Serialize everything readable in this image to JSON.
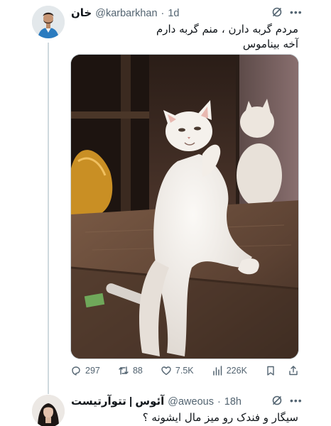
{
  "tweet": {
    "author_name": "خان",
    "handle": "@karbarkhan",
    "time": "1d",
    "text_line1": "مردم گربه دارن ، منم گربه دارم",
    "text_line2": "آخه بیناموس",
    "stats": {
      "replies": "297",
      "retweets": "88",
      "likes": "7.5K",
      "views": "226K"
    }
  },
  "reply": {
    "author_name": "آئوس | تتوآرتیست",
    "handle": "@aweous",
    "time": "18h",
    "text": "سیگار و فندک رو میز مال ایشونه ؟"
  },
  "icons": {
    "reply": "reply-icon",
    "retweet": "retweet-icon",
    "like": "heart-icon",
    "views": "views-icon",
    "bookmark": "bookmark-icon",
    "share": "share-icon",
    "grok": "grok-icon",
    "more": "more-icon"
  },
  "colors": {
    "text": "#0f1419",
    "muted": "#536471",
    "border": "#cfd9de"
  }
}
